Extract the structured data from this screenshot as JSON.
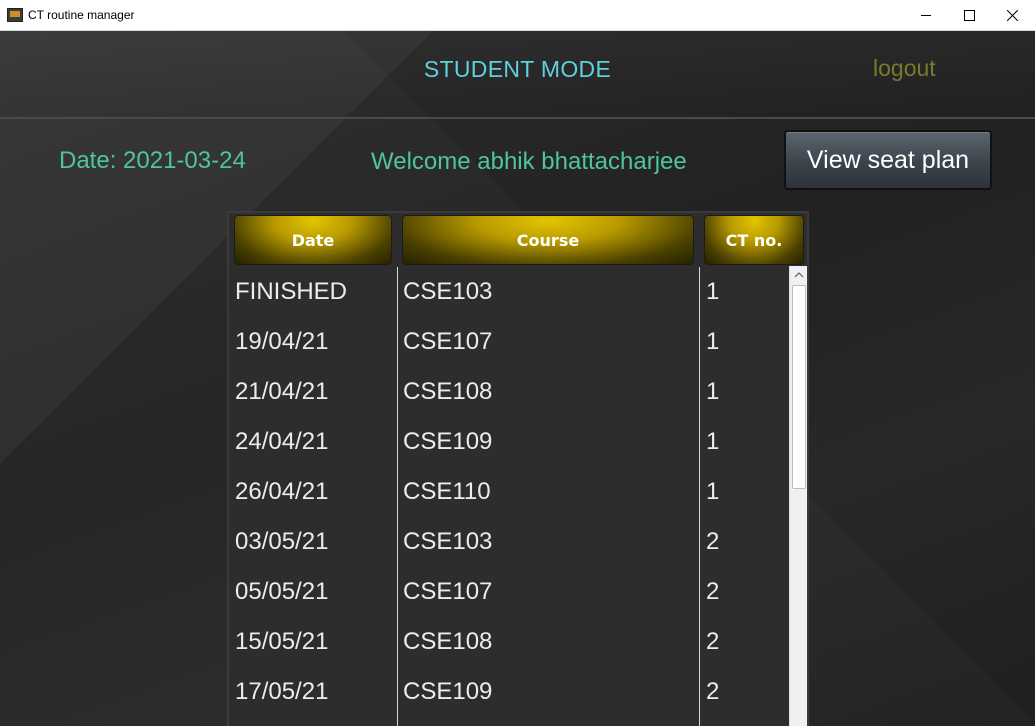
{
  "window": {
    "title": "CT routine manager"
  },
  "header": {
    "mode_title": "STUDENT MODE",
    "logout_label": "logout"
  },
  "info": {
    "date_text": "Date: 2021-03-24",
    "welcome_text": "Welcome abhik bhattacharjee",
    "seat_plan_label": "View seat plan"
  },
  "table": {
    "columns": [
      "Date",
      "Course",
      "CT no."
    ],
    "rows": [
      {
        "date": "FINISHED",
        "course": "CSE103",
        "ct": "1"
      },
      {
        "date": "19/04/21",
        "course": "CSE107",
        "ct": "1"
      },
      {
        "date": "21/04/21",
        "course": "CSE108",
        "ct": "1"
      },
      {
        "date": "24/04/21",
        "course": "CSE109",
        "ct": "1"
      },
      {
        "date": "26/04/21",
        "course": "CSE110",
        "ct": "1"
      },
      {
        "date": "03/05/21",
        "course": "CSE103",
        "ct": "2"
      },
      {
        "date": "05/05/21",
        "course": "CSE107",
        "ct": "2"
      },
      {
        "date": "15/05/21",
        "course": "CSE108",
        "ct": "2"
      },
      {
        "date": "17/05/21",
        "course": "CSE109",
        "ct": "2"
      }
    ]
  },
  "icons": {
    "app": "app-icon",
    "minimize": "minimize-icon",
    "maximize": "maximize-icon",
    "close": "close-icon",
    "scroll_up": "chevron-up-icon"
  },
  "colors": {
    "mode_title": "#5fd0dc",
    "logout": "#7a7a2a",
    "info_text": "#4ec4a0",
    "header_gold": "#e3c400"
  }
}
